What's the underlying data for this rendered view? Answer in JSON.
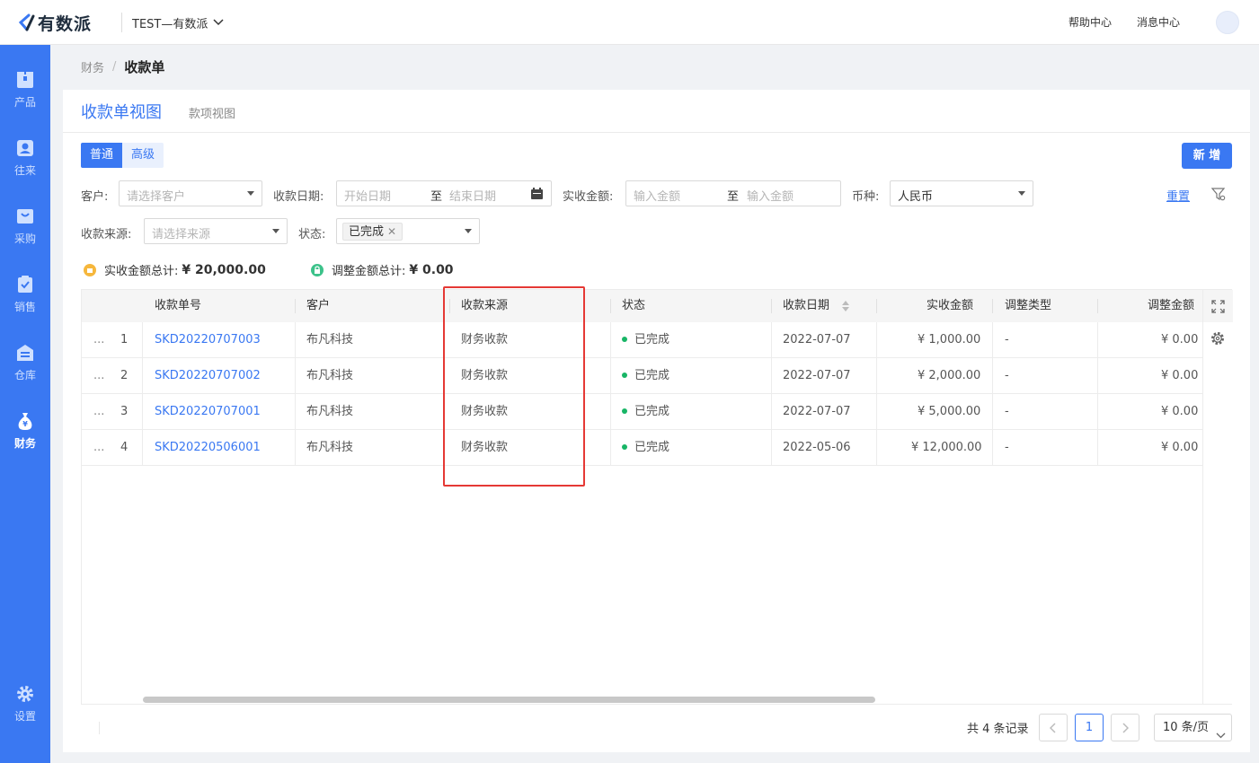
{
  "app": {
    "logo_text": "有数派",
    "org_name": "TEST—有数派",
    "help_center": "帮助中心",
    "message_center": "消息中心"
  },
  "sidebar": {
    "items": [
      {
        "label": "产品",
        "icon": "product-box-icon"
      },
      {
        "label": "往来",
        "icon": "contacts-icon"
      },
      {
        "label": "采购",
        "icon": "purchase-icon"
      },
      {
        "label": "销售",
        "icon": "sales-icon"
      },
      {
        "label": "仓库",
        "icon": "warehouse-icon"
      },
      {
        "label": "财务",
        "icon": "finance-moneybag-icon",
        "active": true
      },
      {
        "label": "设置",
        "icon": "gear-icon"
      }
    ]
  },
  "breadcrumb": {
    "parent": "财务",
    "current": "收款单"
  },
  "view_tabs": {
    "active": "收款单视图",
    "other": "款项视图"
  },
  "mode": {
    "normal": "普通",
    "advanced": "高级"
  },
  "add_button": "新 增",
  "filters": {
    "customer_label": "客户:",
    "customer_placeholder": "请选择客户",
    "date_label": "收款日期:",
    "date_start_placeholder": "开始日期",
    "date_to": "至",
    "date_end_placeholder": "结束日期",
    "amount_label": "实收金额:",
    "amount_min_placeholder": "输入金额",
    "amount_to": "至",
    "amount_max_placeholder": "输入金额",
    "currency_label": "币种:",
    "currency_value": "人民币",
    "source_label": "收款来源:",
    "source_placeholder": "请选择来源",
    "status_label": "状态:",
    "status_tag": "已完成",
    "reset": "重置"
  },
  "summary": {
    "received_label": "实收金额总计:",
    "received_value": "¥ 20,000.00",
    "adjust_label": "调整金额总计:",
    "adjust_value": "¥ 0.00"
  },
  "table": {
    "columns": [
      "收款单号",
      "客户",
      "收款来源",
      "状态",
      "收款日期",
      "实收金额",
      "调整类型",
      "调整金额"
    ],
    "rows": [
      {
        "idx": "1",
        "no": "SKD20220707003",
        "customer": "布凡科技",
        "source": "财务收款",
        "status": "已完成",
        "date": "2022-07-07",
        "amount": "¥ 1,000.00",
        "adj_type": "-",
        "adj_amount": "¥ 0.00"
      },
      {
        "idx": "2",
        "no": "SKD20220707002",
        "customer": "布凡科技",
        "source": "财务收款",
        "status": "已完成",
        "date": "2022-07-07",
        "amount": "¥ 2,000.00",
        "adj_type": "-",
        "adj_amount": "¥ 0.00"
      },
      {
        "idx": "3",
        "no": "SKD20220707001",
        "customer": "布凡科技",
        "source": "财务收款",
        "status": "已完成",
        "date": "2022-07-07",
        "amount": "¥ 5,000.00",
        "adj_type": "-",
        "adj_amount": "¥ 0.00"
      },
      {
        "idx": "4",
        "no": "SKD20220506001",
        "customer": "布凡科技",
        "source": "财务收款",
        "status": "已完成",
        "date": "2022-05-06",
        "amount": "¥ 12,000.00",
        "adj_type": "-",
        "adj_amount": "¥ 0.00"
      }
    ],
    "row_menu": "..."
  },
  "pagination": {
    "total": "共 4 条记录",
    "current_page": "1",
    "page_size": "10 条/页"
  },
  "colors": {
    "primary": "#3a78f2",
    "sidebar": "#3a78f2",
    "status_done": "#18b566",
    "highlight": "#e53935"
  }
}
